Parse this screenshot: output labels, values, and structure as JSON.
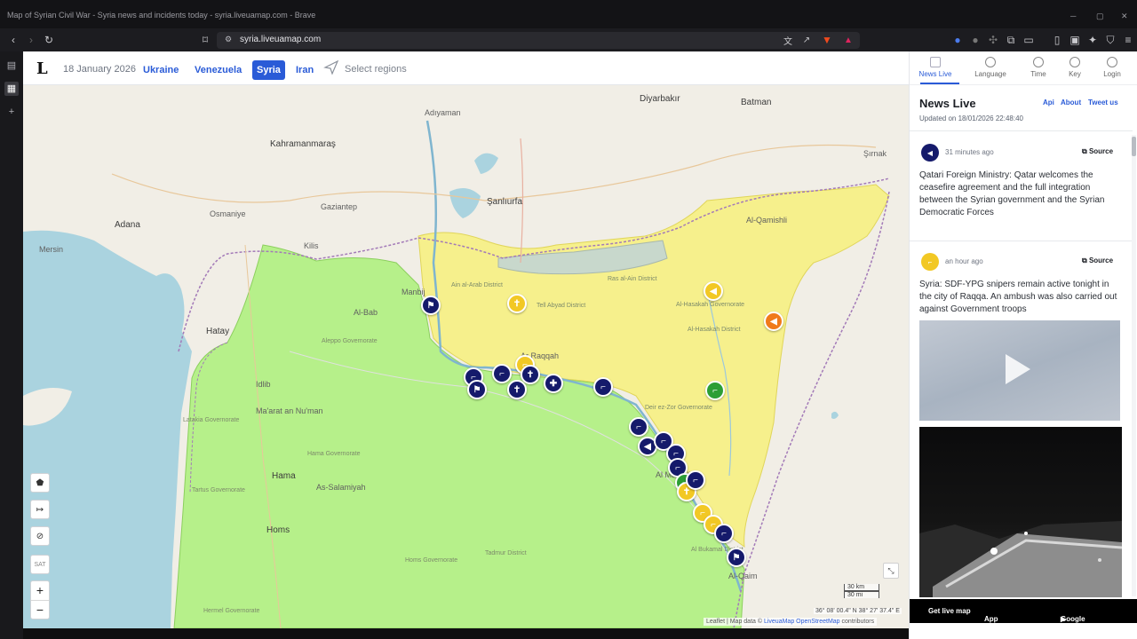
{
  "window": {
    "title": "Map of Syrian Civil War - Syria news and incidents today - syria.liveuamap.com - Brave",
    "url": "syria.liveuamap.com"
  },
  "header": {
    "date": "18 January 2026",
    "regions": [
      "Ukraine",
      "Venezuela",
      "Syria",
      "Iran"
    ],
    "active_region": "Syria",
    "select_regions": "Select regions"
  },
  "panel": {
    "tabs": [
      "News Live",
      "Language",
      "Time",
      "Key",
      "Login"
    ],
    "title": "News Live",
    "links": [
      "Api",
      "About",
      "Tweet us"
    ],
    "updated": "Updated on 18/01/2026 22:48:40",
    "items": [
      {
        "time": "31 minutes ago",
        "source": "Source",
        "text": "Qatari Foreign Ministry: Qatar welcomes the ceasefire agreement and the full integration between the Syrian government and the Syrian Democratic Forces",
        "icon": "megaphone-icon",
        "color": "#151a6b"
      },
      {
        "time": "an hour ago",
        "source": "Source",
        "text": "Syria: SDF-YPG snipers remain active tonight in the city of Raqqa. An ambush was also carried out against Government troops",
        "icon": "rifle-icon",
        "color": "#f2c824"
      }
    ],
    "app_bar": {
      "get": "Get live map",
      "app_store": "App Store",
      "google_play": "Google Play"
    }
  },
  "map": {
    "labels": {
      "diyarbakir": "Diyarbakır",
      "batman": "Batman",
      "adiyaman": "Adıyaman",
      "kahramanmaras": "Kahramanmaraş",
      "adana": "Adana",
      "osmaniye": "Osmaniye",
      "gaziantep": "Gaziantep",
      "sanliurfa": "Şanlıurfa",
      "mersin": "Mersin",
      "hatay": "Hatay",
      "kilis": "Kilis",
      "manbij": "Manbij",
      "al_bab": "Al-Bab",
      "aleppo_gov": "Aleppo Governorate",
      "idlib": "Idlib",
      "latakia": "Latakia Governorate",
      "maarat": "Ma'arat an Nu'man",
      "hama": "Hama",
      "hama_gov": "Hama Governorate",
      "tartus": "Tartus Governorate",
      "homs": "Homs",
      "homs_gov": "Homs Governorate",
      "salamiyah": "As-Salamiyah",
      "palmyra": "Tadmur District",
      "ain_al_arab": "Ain al-Arab District",
      "tell_abyad": "Tell Abyad District",
      "ras_al_ain": "Ras al-Ain District",
      "raqqa": "Ar Raqqah",
      "hasakah": "Al-Hasakah Governorate",
      "hasakah_dist": "Al-Hasakah District",
      "qamishli": "Al-Qamishli",
      "mayadin": "Al Mayadin",
      "bukamal": "Al Bukamal District",
      "deir": "Deir ez-Zor Governorate",
      "qaim": "Al-Qaim",
      "sirnak": "Şırnak",
      "hermel": "Hermel Governorate"
    },
    "controls": {
      "sat": "SAT",
      "zoom_in": "+",
      "zoom_out": "−"
    },
    "scale_km": "30 km",
    "scale_mi": "30 mi",
    "coords": "36° 08' 00.4\" N 38° 27' 37.4\" E",
    "attribution_prefix": "Leaflet | Map data ©",
    "attribution_links": "LiveuaMap OpenStreetMap",
    "attribution_suffix": "contributors",
    "markers": [
      {
        "color": "blue",
        "icon": "flag-icon"
      },
      {
        "color": "yellow",
        "icon": "grave-icon"
      },
      {
        "color": "blue",
        "icon": "rifle-icon"
      },
      {
        "color": "blue",
        "icon": "flag-icon"
      },
      {
        "color": "blue",
        "icon": "rifle-icon"
      },
      {
        "color": "yellow",
        "icon": "rifle-icon"
      },
      {
        "color": "blue",
        "icon": "grave-icon"
      },
      {
        "color": "blue",
        "icon": "grave-icon"
      },
      {
        "color": "blue",
        "icon": "medical-icon"
      },
      {
        "color": "blue",
        "icon": "rifle-icon"
      },
      {
        "color": "yellow",
        "icon": "megaphone-icon"
      },
      {
        "color": "orange",
        "icon": "megaphone-icon"
      },
      {
        "color": "green",
        "icon": "rifle-icon"
      },
      {
        "color": "blue",
        "icon": "rifle-icon"
      },
      {
        "color": "blue",
        "icon": "megaphone-icon"
      },
      {
        "color": "blue",
        "icon": "rifle-icon"
      },
      {
        "color": "blue",
        "icon": "rifle-icon"
      },
      {
        "color": "blue",
        "icon": "rifle-icon"
      },
      {
        "color": "green",
        "icon": "rifle-icon"
      },
      {
        "color": "yellow",
        "icon": "grave-icon"
      },
      {
        "color": "yellow",
        "icon": "rifle-icon"
      },
      {
        "color": "yellow",
        "icon": "rifle-icon"
      },
      {
        "color": "blue",
        "icon": "rifle-icon"
      },
      {
        "color": "blue",
        "icon": "rifle-icon"
      },
      {
        "color": "blue",
        "icon": "flag-icon"
      }
    ],
    "zone_colors": {
      "government": "#b6f08a",
      "sdf": "#f6f08c",
      "turkey_zone": "#c8d8cc",
      "water": "#aad3df"
    }
  }
}
